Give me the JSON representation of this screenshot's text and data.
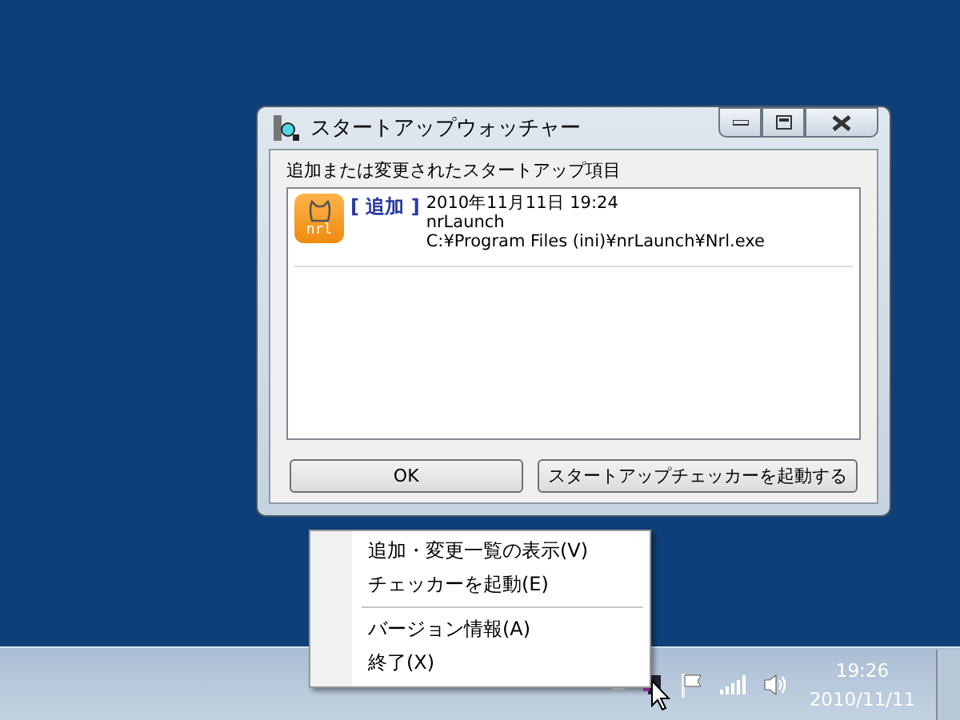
{
  "window": {
    "title": "スタートアップウォッチャー"
  },
  "list": {
    "label": "追加または変更されたスタートアップ項目",
    "entries": [
      {
        "tag": "[ 追加 ]",
        "timestamp": "2010年11月11日  19:24",
        "name": "nrLaunch",
        "path": "C:¥Program Files (ini)¥nrLaunch¥Nrl.exe",
        "icon_text": "nrl"
      }
    ]
  },
  "buttons": [
    "OK",
    "スタートアップチェッカーを起動する"
  ],
  "context_menu": {
    "items": [
      {
        "kind": "item",
        "label": "追加・変更一覧の表示(V)"
      },
      {
        "kind": "item",
        "label": "チェッカーを起動(E)"
      },
      {
        "kind": "separator"
      },
      {
        "kind": "item",
        "label": "バージョン情報(A)"
      },
      {
        "kind": "item",
        "label": "終了(X)"
      }
    ]
  },
  "taskbar": {
    "time": "19:26",
    "date": "2010/11/11"
  }
}
